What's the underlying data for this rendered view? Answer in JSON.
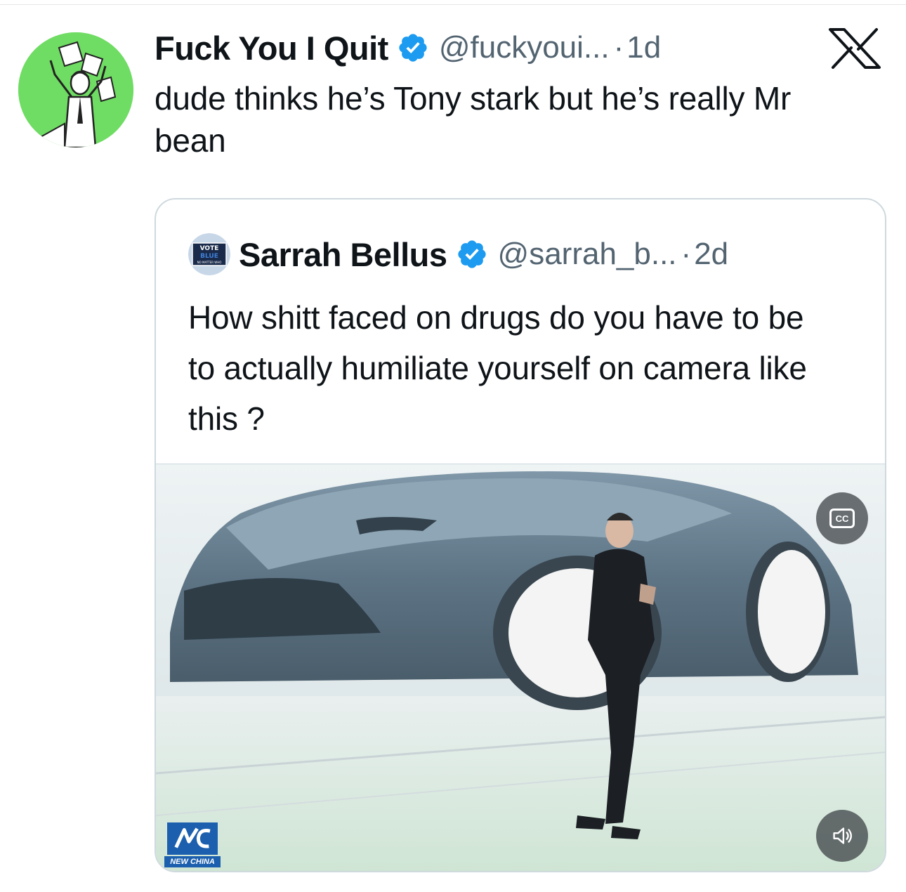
{
  "tweet": {
    "author_name": "Fuck You I Quit",
    "handle": "@fuckyoui...",
    "separator": "·",
    "time": "1d",
    "text": "dude thinks he’s Tony stark but he’s really Mr bean",
    "verified_color": "#1d9bf0"
  },
  "quote": {
    "author_name": "Sarrah Bellus",
    "handle": "@sarrah_b...",
    "separator": "·",
    "time": "2d",
    "text": "How shitt faced on drugs do you have to be to actually humiliate yourself on camera like this ?",
    "avatar_text": "VOTE BLUE",
    "avatar_subtext": "NO MATTER WHO"
  },
  "media": {
    "cc_label": "CC",
    "watermark_caption": "NEW CHINA"
  },
  "colors": {
    "avatar_bg": "#6fdc63",
    "secondary_text": "#536471",
    "border": "#cfd9de"
  }
}
